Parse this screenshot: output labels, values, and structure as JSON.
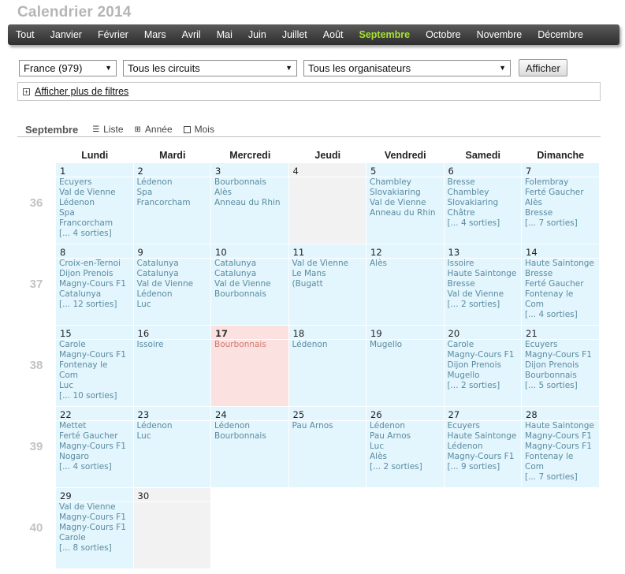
{
  "page_title": "Calendrier 2014",
  "nav": {
    "items": [
      "Tout",
      "Janvier",
      "Février",
      "Mars",
      "Avril",
      "Mai",
      "Juin",
      "Juillet",
      "Août",
      "Septembre",
      "Octobre",
      "Novembre",
      "Décembre"
    ],
    "active_index": 9
  },
  "filters": {
    "country": "France (979)",
    "circuit": "Tous les circuits",
    "organizer": "Tous les organisateurs",
    "submit": "Afficher",
    "more_filters": "Afficher plus de filtres"
  },
  "view": {
    "current_month": "Septembre",
    "list": "Liste",
    "year": "Année",
    "month": "Mois"
  },
  "days_of_week": [
    "Lundi",
    "Mardi",
    "Mercredi",
    "Jeudi",
    "Vendredi",
    "Samedi",
    "Dimanche"
  ],
  "weeks": [
    {
      "number": "36",
      "days": [
        {
          "day": "1",
          "events": [
            "Ecuyers",
            "Val de Vienne",
            "Lédenon",
            "Spa",
            "Francorcham"
          ],
          "more": "[... 4 sorties]"
        },
        {
          "day": "2",
          "events": [
            "Lédenon",
            "Spa",
            "Francorcham"
          ]
        },
        {
          "day": "3",
          "events": [
            "Bourbonnais",
            "Alès",
            "Anneau du Rhin"
          ]
        },
        {
          "day": "4",
          "events": [],
          "state": "empty"
        },
        {
          "day": "5",
          "events": [
            "Chambley",
            "Slovakiaring",
            "Val de Vienne",
            "Anneau du Rhin"
          ]
        },
        {
          "day": "6",
          "events": [
            "Bresse",
            "Chambley",
            "Slovakiaring",
            "Châtre"
          ],
          "more": "[... 4 sorties]"
        },
        {
          "day": "7",
          "events": [
            "Folembray",
            "Ferté Gaucher",
            "Alès",
            "Bresse"
          ],
          "more": "[... 7 sorties]"
        }
      ]
    },
    {
      "number": "37",
      "days": [
        {
          "day": "8",
          "events": [
            "Croix-en-Ternoi",
            "Dijon Prenois",
            "Magny-Cours F1",
            "Catalunya"
          ],
          "more": "[... 12 sorties]"
        },
        {
          "day": "9",
          "events": [
            "Catalunya",
            "Catalunya",
            "Val de Vienne",
            "Lédenon",
            "Luc"
          ]
        },
        {
          "day": "10",
          "events": [
            "Catalunya",
            "Catalunya",
            "Val de Vienne",
            "Bourbonnais"
          ]
        },
        {
          "day": "11",
          "events": [
            "Val de Vienne",
            "Le Mans",
            "(Bugatt"
          ]
        },
        {
          "day": "12",
          "events": [
            "Alès"
          ]
        },
        {
          "day": "13",
          "events": [
            "Issoire",
            "Haute Saintonge",
            "Bresse",
            "Val de Vienne"
          ],
          "more": "[... 2 sorties]"
        },
        {
          "day": "14",
          "events": [
            "Haute Saintonge",
            "Bresse",
            "Ferté Gaucher",
            "Fontenay le",
            "Com"
          ],
          "more": "[... 4 sorties]"
        }
      ]
    },
    {
      "number": "38",
      "days": [
        {
          "day": "15",
          "events": [
            "Carole",
            "Magny-Cours F1",
            "Fontenay le",
            "Com",
            "Luc"
          ],
          "more": "[... 10 sorties]"
        },
        {
          "day": "16",
          "events": [
            "Issoire"
          ]
        },
        {
          "day": "17",
          "events": [
            "Bourbonnais"
          ],
          "state": "today"
        },
        {
          "day": "18",
          "events": [
            "Lédenon"
          ]
        },
        {
          "day": "19",
          "events": [
            "Mugello"
          ]
        },
        {
          "day": "20",
          "events": [
            "Carole",
            "Magny-Cours F1",
            "Dijon Prenois",
            "Mugello"
          ],
          "more": "[... 2 sorties]"
        },
        {
          "day": "21",
          "events": [
            "Ecuyers",
            "Magny-Cours F1",
            "Dijon Prenois",
            "Bourbonnais"
          ],
          "more": "[... 5 sorties]"
        }
      ]
    },
    {
      "number": "39",
      "days": [
        {
          "day": "22",
          "events": [
            "Mettet",
            "Ferté Gaucher",
            "Magny-Cours F1",
            "Nogaro"
          ],
          "more": "[... 4 sorties]"
        },
        {
          "day": "23",
          "events": [
            "Lédenon",
            "Luc"
          ]
        },
        {
          "day": "24",
          "events": [
            "Lédenon",
            "Bourbonnais"
          ]
        },
        {
          "day": "25",
          "events": [
            "Pau Arnos"
          ]
        },
        {
          "day": "26",
          "events": [
            "Lédenon",
            "Pau Arnos",
            "Luc",
            "Alès"
          ],
          "more": "[... 2 sorties]"
        },
        {
          "day": "27",
          "events": [
            "Ecuyers",
            "Haute Saintonge",
            "Lédenon",
            "Magny-Cours F1"
          ],
          "more": "[... 9 sorties]"
        },
        {
          "day": "28",
          "events": [
            "Haute Saintonge",
            "Magny-Cours F1",
            "Magny-Cours F1",
            "Fontenay le",
            "Com"
          ],
          "more": "[... 7 sorties]"
        }
      ]
    },
    {
      "number": "40",
      "days": [
        {
          "day": "29",
          "events": [
            "Val de Vienne",
            "Magny-Cours F1",
            "Magny-Cours F1",
            "Carole"
          ],
          "more": "[... 8 sorties]"
        },
        {
          "day": "30",
          "events": [],
          "state": "empty"
        }
      ]
    }
  ],
  "colors": {
    "cell_bg": "#e3f5fd",
    "event_text": "#5a8ca0",
    "today_bg": "#fbe2e0",
    "today_text": "#d0776b",
    "nav_active": "#a6e22e",
    "week_number": "#c3c3c3"
  }
}
